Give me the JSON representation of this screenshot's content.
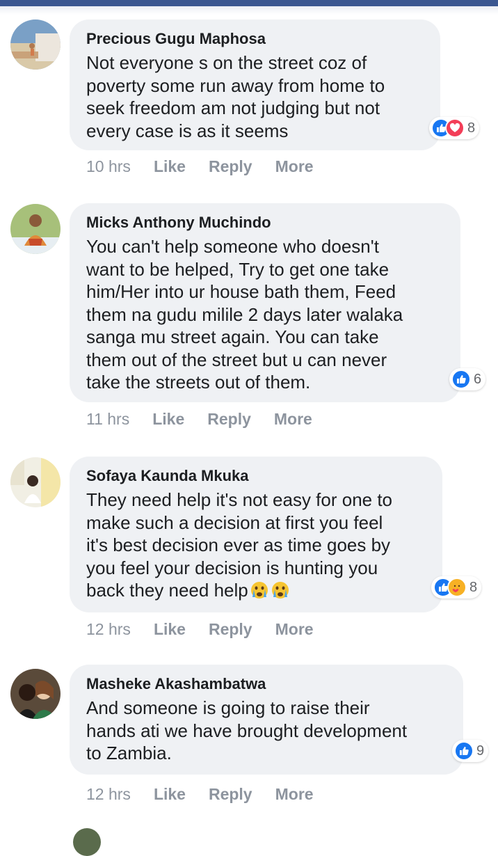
{
  "comments": [
    {
      "author": "Precious Gugu Maphosa",
      "text": "Not everyone s on the street coz of\npoverty some run away from home to\nseek freedom am not judging but not\nevery case is as it seems",
      "time": "10 hrs",
      "like": "Like",
      "reply": "Reply",
      "more": "More",
      "reaction_count": "8",
      "reactions": [
        "like-icon",
        "love-icon"
      ]
    },
    {
      "author": "Micks Anthony Muchindo",
      "text": "You can't help someone who doesn't\nwant to be helped, Try to get one take\nhim/Her into ur house bath them, Feed\nthem na gudu milile 2 days later walaka\nsanga mu street again. You can take\nthem out of the street but u can never\ntake the streets out of them.",
      "time": "11 hrs",
      "like": "Like",
      "reply": "Reply",
      "more": "More",
      "reaction_count": "6",
      "reactions": [
        "like-icon"
      ]
    },
    {
      "author": "Sofaya Kaunda Mkuka",
      "text": "They need help it's not easy for one to\nmake such a decision at first you feel\nit's best decision ever as time goes by\nyou feel your decision is hunting you\nback they need help",
      "time": "12 hrs",
      "like": "Like",
      "reply": "Reply",
      "more": "More",
      "reaction_count": "8",
      "reactions": [
        "like-icon",
        "care-icon"
      ],
      "emojis": [
        "crying-face-emoji",
        "crying-face-emoji"
      ]
    },
    {
      "author": "Masheke Akashambatwa",
      "text": "And someone is going to raise their\nhands ati we have brought development\nto Zambia.",
      "time": "12 hrs",
      "like": "Like",
      "reply": "Reply",
      "more": "More",
      "reaction_count": "9",
      "reactions": [
        "like-icon"
      ]
    }
  ],
  "colors": {
    "header": "#3b5790",
    "bubble": "#eff1f4",
    "like": "#1877f2",
    "love": "#f33e58",
    "muted": "#8d949e"
  }
}
